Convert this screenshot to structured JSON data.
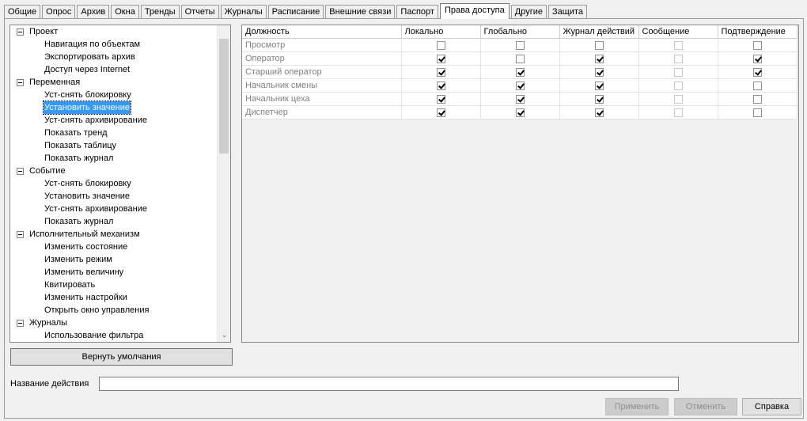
{
  "tabs": [
    "Общие",
    "Опрос",
    "Архив",
    "Окна",
    "Тренды",
    "Отчеты",
    "Журналы",
    "Расписание",
    "Внешние связи",
    "Паспорт",
    "Права доступа",
    "Другие",
    "Защита"
  ],
  "active_tab": "Права доступа",
  "tree": {
    "items": [
      {
        "label": "Проект",
        "level": 0
      },
      {
        "label": "Навигация по объектам",
        "level": 1
      },
      {
        "label": "Экспортировать архив",
        "level": 1
      },
      {
        "label": "Доступ через Internet",
        "level": 1
      },
      {
        "label": "Переменная",
        "level": 0
      },
      {
        "label": "Уст-снять блокировку",
        "level": 1
      },
      {
        "label": "Установить значение",
        "level": 1,
        "selected": true
      },
      {
        "label": "Уст-снять архивирование",
        "level": 1
      },
      {
        "label": "Показать тренд",
        "level": 1
      },
      {
        "label": "Показать таблицу",
        "level": 1
      },
      {
        "label": "Показать журнал",
        "level": 1
      },
      {
        "label": "Событие",
        "level": 0
      },
      {
        "label": "Уст-снять блокировку",
        "level": 1
      },
      {
        "label": "Установить значение",
        "level": 1
      },
      {
        "label": "Уст-снять архивирование",
        "level": 1
      },
      {
        "label": "Показать журнал",
        "level": 1
      },
      {
        "label": "Исполнительный механизм",
        "level": 0
      },
      {
        "label": "Изменить состояние",
        "level": 1
      },
      {
        "label": "Изменить режим",
        "level": 1
      },
      {
        "label": "Изменить величину",
        "level": 1
      },
      {
        "label": "Квитировать",
        "level": 1
      },
      {
        "label": "Изменить настройки",
        "level": 1
      },
      {
        "label": "Открыть окно управления",
        "level": 1
      },
      {
        "label": "Журналы",
        "level": 0
      },
      {
        "label": "Использование фильтра",
        "level": 1
      }
    ]
  },
  "grid": {
    "columns": [
      "Должность",
      "Локально",
      "Глобально",
      "Журнал действий",
      "Сообщение",
      "Подтверждение"
    ],
    "rows": [
      {
        "role": "Просмотр",
        "values": [
          false,
          false,
          false,
          false,
          false
        ]
      },
      {
        "role": "Оператор",
        "values": [
          true,
          false,
          true,
          false,
          true
        ]
      },
      {
        "role": "Старший оператор",
        "values": [
          true,
          true,
          true,
          false,
          true
        ]
      },
      {
        "role": "Начальник смены",
        "values": [
          true,
          true,
          true,
          false,
          false
        ]
      },
      {
        "role": "Начальник цеха",
        "values": [
          true,
          true,
          true,
          false,
          false
        ]
      },
      {
        "role": "Диспетчер",
        "values": [
          true,
          true,
          true,
          false,
          false
        ]
      }
    ]
  },
  "buttons": {
    "reset_defaults": "Вернуть умолчания",
    "apply": "Применить",
    "cancel": "Отменить",
    "help": "Справка"
  },
  "action_name": {
    "label": "Название действия",
    "value": ""
  }
}
